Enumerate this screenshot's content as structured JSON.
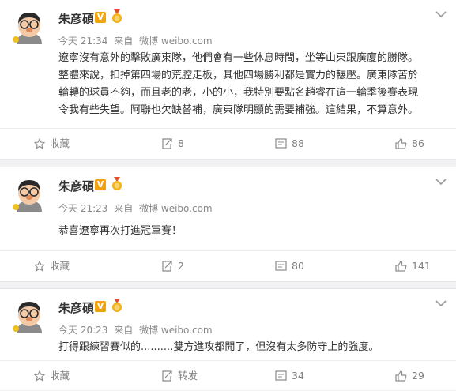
{
  "posts": [
    {
      "author": "朱彦碩",
      "vip_badge": "V",
      "time": "今天 21:34",
      "source_prefix": "来自",
      "source": "微博 weibo.com",
      "lines": [
        "遼寧沒有意外的擊敗廣東隊，他們會有一些休息時間，坐等山東跟廣廈的勝隊。",
        "整體來說，扣掉第四場的荒腔走板，其他四場勝利都是實力的輾壓。廣東隊苦於",
        "輪轉的球員不夠，而且老的老，小的小，我特別要點名趙睿在這一輪季後賽表現",
        "令我有些失望。阿聯也欠缺替補，廣東隊明顯的需要補強。這結果，不算意外。"
      ],
      "actions": {
        "favorite": "收藏",
        "repost": "8",
        "comment": "88",
        "like": "86"
      }
    },
    {
      "author": "朱彦碩",
      "vip_badge": "V",
      "time": "今天 21:23",
      "source_prefix": "来自",
      "source": "微博 weibo.com",
      "lines": [
        "恭喜遼寧再次打進冠軍賽！"
      ],
      "actions": {
        "favorite": "收藏",
        "repost": "2",
        "comment": "80",
        "like": "141"
      }
    },
    {
      "author": "朱彦碩",
      "vip_badge": "V",
      "time": "今天 20:23",
      "source_prefix": "来自",
      "source": "微博 weibo.com",
      "lines": [
        "打得跟練習賽似的..........雙方進攻都開了，但沒有太多防守上的強度。"
      ],
      "actions": {
        "favorite": "收藏",
        "repost": "转发",
        "comment": "34",
        "like": "29"
      }
    }
  ],
  "colors": {
    "background": "#f2f2f5",
    "vip_badge": "#f2a20c",
    "meta_text": "#888888",
    "action_text": "#808080"
  },
  "icons": [
    "chevron-down-icon",
    "star-icon",
    "repost-icon",
    "comment-icon",
    "thumbs-up-icon",
    "medal-icon"
  ]
}
